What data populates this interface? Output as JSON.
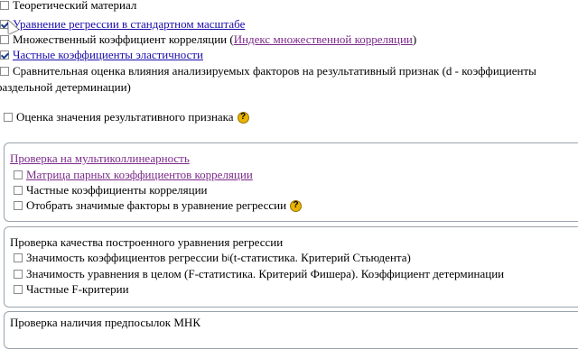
{
  "top_items": [
    {
      "label": "Теоретический материал",
      "checked": false
    },
    {
      "label": "Уравнение регрессии в стандартном масштабе",
      "checked": true
    },
    {
      "label_before": "Множественный коэффициент корреляции (",
      "link": "Индекс множественной корреляции",
      "label_after": ")",
      "checked": false
    },
    {
      "label": "Частные коэффициенты эластичности",
      "checked": true
    },
    {
      "label_line1": "Сравнительная оценка влияния анализируемых факторов на результативный признак (d - коэффициенты",
      "label_line2": "раздельной детерминации)",
      "checked": false
    }
  ],
  "estimate_item": {
    "label": "Оценка значения результативного признака",
    "checked": false
  },
  "multicollinearity": {
    "title": "Проверка на мультиколлинеарность",
    "items": [
      {
        "label": "Матрица парных коэффициентов корреляции",
        "checked": false
      },
      {
        "label": "Частные коэффициенты корреляции",
        "checked": false
      },
      {
        "label": "Отобрать значимые факторы в уравнение регрессии",
        "checked": false
      }
    ]
  },
  "quality": {
    "title": "Проверка качества построенного уравнения регрессии",
    "items": [
      {
        "label_before": "Значимость коэффициентов регрессии b",
        "sub": "i",
        "label_after": "(t-статистика. Критерий Стьюдента)",
        "checked": false
      },
      {
        "label": "Значимость уравнения в целом (F-статистика. Критерий Фишера). Коэффициент детерминации",
        "checked": false
      },
      {
        "label": "Частные F-критерии",
        "checked": false
      }
    ]
  },
  "next_panel": {
    "title": "Проверка наличия предпосылок МНК"
  },
  "icons": {
    "help": "question-icon",
    "cursor": "mouse-cursor-icon"
  },
  "help_glyph": "?"
}
